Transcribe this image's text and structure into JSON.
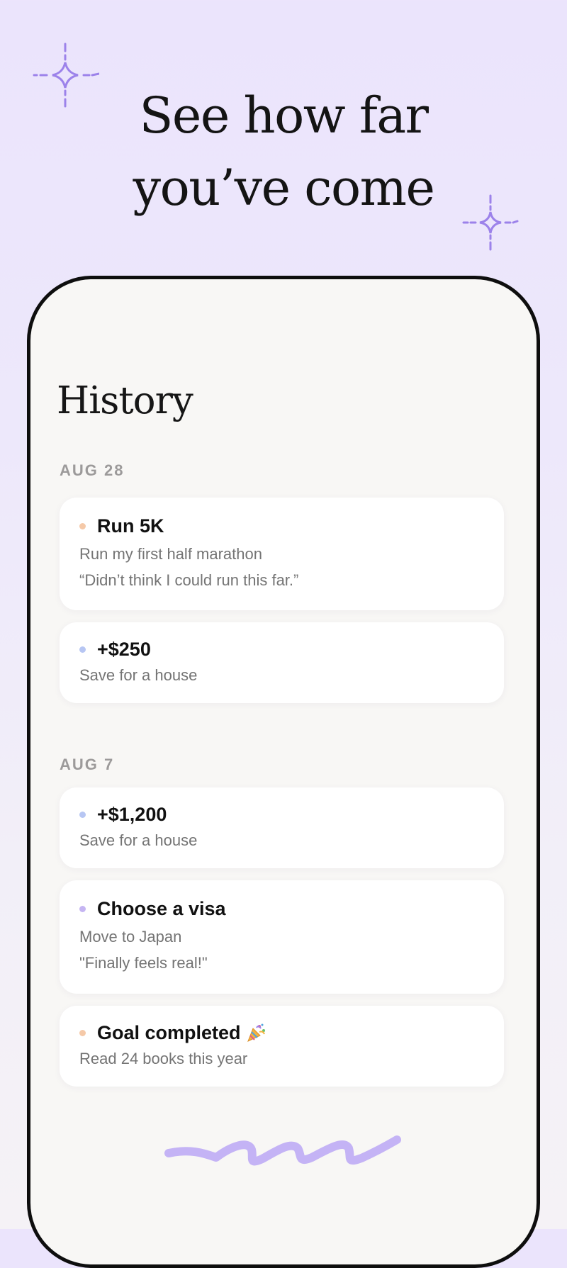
{
  "headline": {
    "line1": "See how far",
    "line2": "you’ve come"
  },
  "screen": {
    "title": "History"
  },
  "colors": {
    "dot_orange": "#f5c9a8",
    "dot_blue": "#b7c6f3",
    "dot_purple": "#c5b5f2",
    "accent_purple": "#b8a2f1"
  },
  "groups": [
    {
      "date": "AUG 28",
      "items": [
        {
          "title": "Run 5K",
          "subtitle": "Run my first half marathon",
          "note": "“Didn’t think I could run this far.”",
          "dot": "dot_orange"
        },
        {
          "title": "+$250",
          "subtitle": "Save for a house",
          "dot": "dot_blue"
        }
      ]
    },
    {
      "date": "AUG 7",
      "items": [
        {
          "title": "+$1,200",
          "subtitle": "Save for a house",
          "dot": "dot_blue"
        },
        {
          "title": "Choose a visa",
          "subtitle": "Move to Japan",
          "note": "\"Finally feels real!\"",
          "dot": "dot_purple"
        },
        {
          "title": "Goal completed",
          "icon": "party-popper-icon",
          "subtitle": "Read 24 books this year",
          "dot": "dot_orange"
        }
      ]
    }
  ]
}
